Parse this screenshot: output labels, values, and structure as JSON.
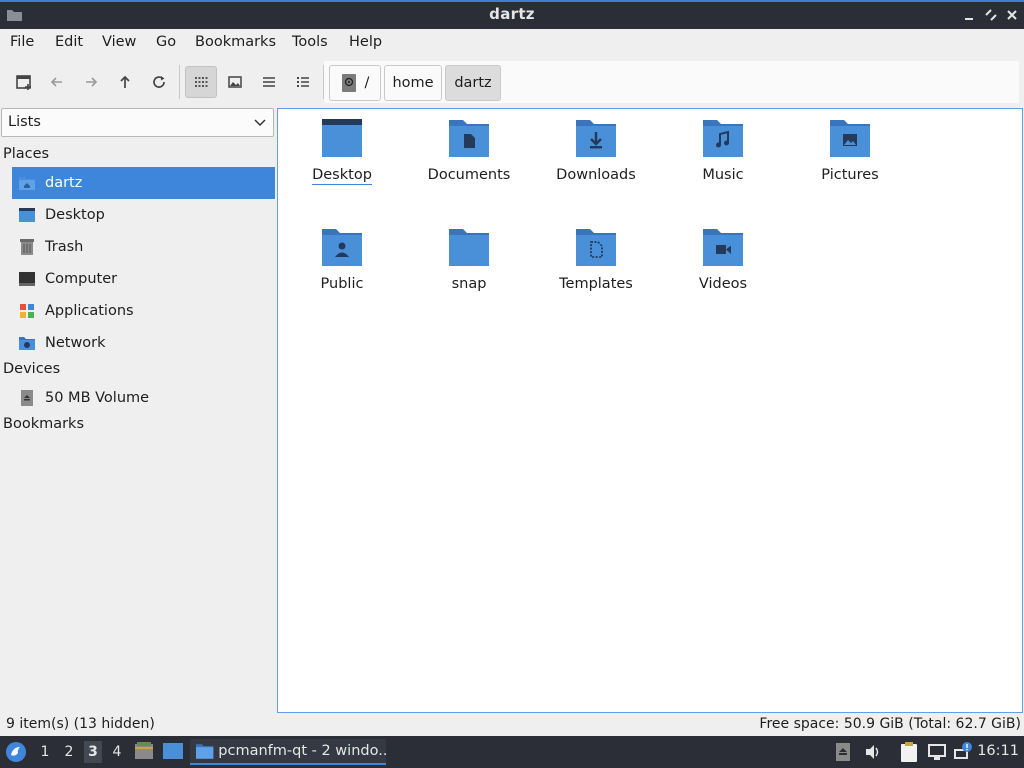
{
  "window": {
    "title": "dartz"
  },
  "menu": [
    "File",
    "Edit",
    "View",
    "Go",
    "Bookmarks",
    "Tools",
    "Help"
  ],
  "pathbar": {
    "root": "/",
    "crumbs": [
      "home",
      "dartz"
    ]
  },
  "sidebar": {
    "mode": "Lists",
    "places_header": "Places",
    "places": [
      "dartz",
      "Desktop",
      "Trash",
      "Computer",
      "Applications",
      "Network"
    ],
    "devices_header": "Devices",
    "devices": [
      "50 MB Volume"
    ],
    "bookmarks_header": "Bookmarks"
  },
  "files": [
    {
      "name": "Desktop",
      "icon": "desktop-folder-icon"
    },
    {
      "name": "Documents",
      "icon": "documents-folder-icon"
    },
    {
      "name": "Downloads",
      "icon": "downloads-folder-icon"
    },
    {
      "name": "Music",
      "icon": "music-folder-icon"
    },
    {
      "name": "Pictures",
      "icon": "pictures-folder-icon"
    },
    {
      "name": "Public",
      "icon": "public-folder-icon"
    },
    {
      "name": "snap",
      "icon": "folder-icon"
    },
    {
      "name": "Templates",
      "icon": "templates-folder-icon"
    },
    {
      "name": "Videos",
      "icon": "videos-folder-icon"
    }
  ],
  "status": {
    "left": "9 item(s) (13 hidden)",
    "right": "Free space: 50.9 GiB (Total: 62.7 GiB)"
  },
  "taskbar": {
    "desktops": [
      "1",
      "2",
      "3",
      "4"
    ],
    "task_label": "pcmanfm-qt - 2 windo...",
    "clock": "16:11"
  },
  "colors": {
    "accent": "#3d86dc",
    "folder": "#4a90d9",
    "folder_tab": "#3a74bd",
    "titlebar": "#2b2e36"
  }
}
